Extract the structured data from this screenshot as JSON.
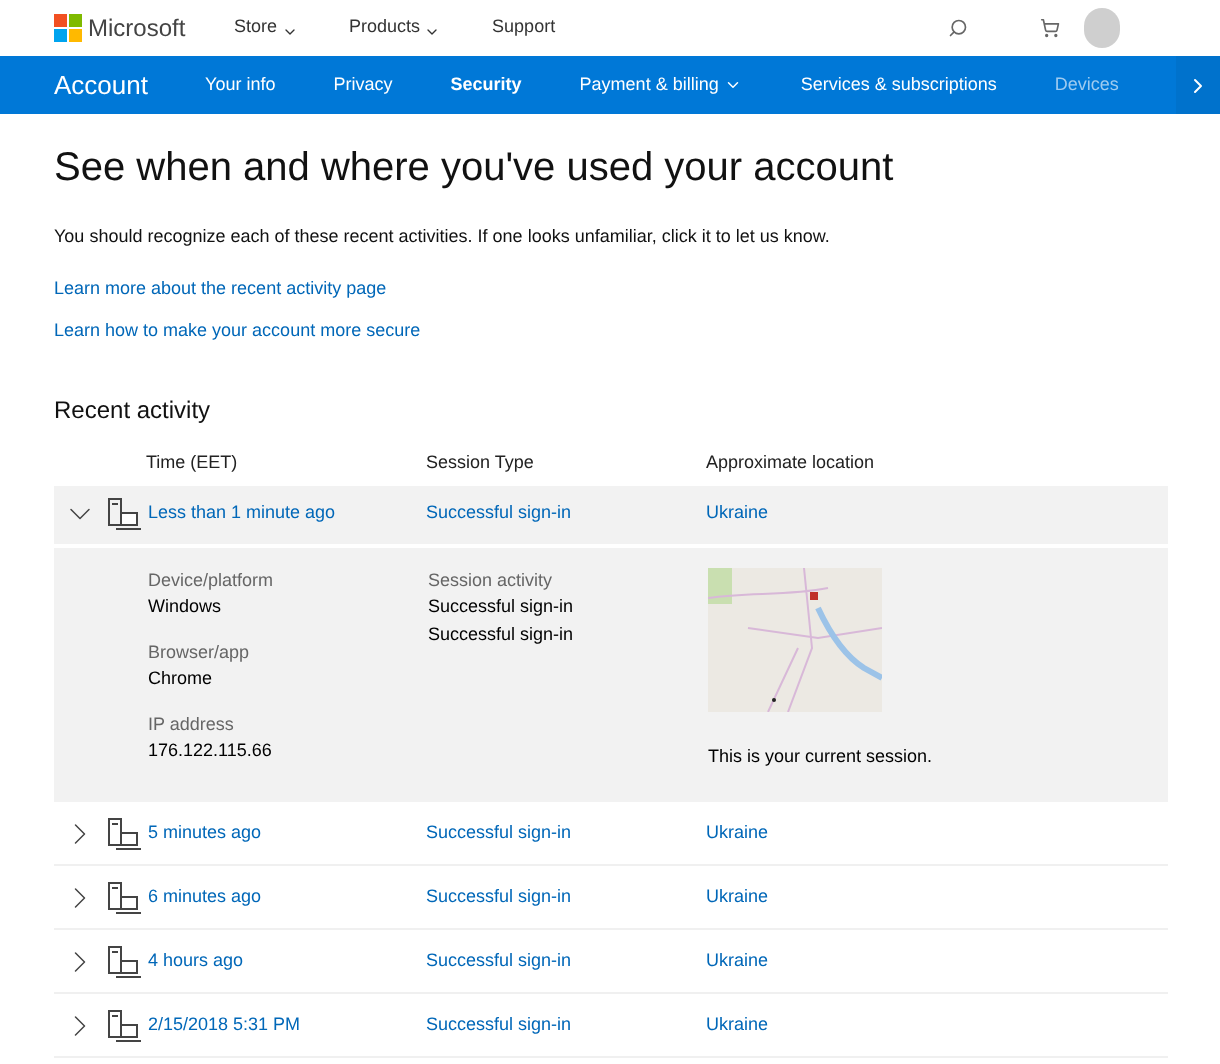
{
  "header": {
    "brand": "Microsoft",
    "menu": [
      {
        "label": "Store",
        "dropdown": true
      },
      {
        "label": "Products",
        "dropdown": true
      },
      {
        "label": "Support",
        "dropdown": false
      }
    ]
  },
  "nav": {
    "title": "Account",
    "tabs": [
      {
        "label": "Your info",
        "selected": false,
        "dropdown": false
      },
      {
        "label": "Privacy",
        "selected": false,
        "dropdown": false
      },
      {
        "label": "Security",
        "selected": true,
        "dropdown": false
      },
      {
        "label": "Payment & billing",
        "selected": false,
        "dropdown": true
      },
      {
        "label": "Services & subscriptions",
        "selected": false,
        "dropdown": false
      },
      {
        "label": "Devices",
        "selected": false,
        "dropdown": false
      }
    ]
  },
  "page": {
    "title": "See when and where you've used your account",
    "intro": "You should recognize each of these recent activities. If one looks unfamiliar, click it to let us know.",
    "links": [
      "Learn more about the recent activity page",
      "Learn how to make your account more secure"
    ]
  },
  "activity": {
    "heading": "Recent activity",
    "columns": [
      "Time (EET)",
      "Session Type",
      "Approximate location"
    ],
    "rows": [
      {
        "time": "Less than 1 minute ago",
        "session_type": "Successful sign-in",
        "location": "Ukraine",
        "expanded": true,
        "details": {
          "device_label": "Device/platform",
          "device": "Windows",
          "browser_label": "Browser/app",
          "browser": "Chrome",
          "ip_label": "IP address",
          "ip": "176.122.115.66",
          "session_label": "Session activity",
          "session_activity": [
            "Successful sign-in",
            "Successful sign-in"
          ],
          "session_note": "This is your current session."
        }
      },
      {
        "time": "5 minutes ago",
        "session_type": "Successful sign-in",
        "location": "Ukraine",
        "expanded": false
      },
      {
        "time": "6 minutes ago",
        "session_type": "Successful sign-in",
        "location": "Ukraine",
        "expanded": false
      },
      {
        "time": "4 hours ago",
        "session_type": "Successful sign-in",
        "location": "Ukraine",
        "expanded": false
      },
      {
        "time": "2/15/2018 5:31 PM",
        "session_type": "Successful sign-in",
        "location": "Ukraine",
        "expanded": false
      }
    ]
  }
}
